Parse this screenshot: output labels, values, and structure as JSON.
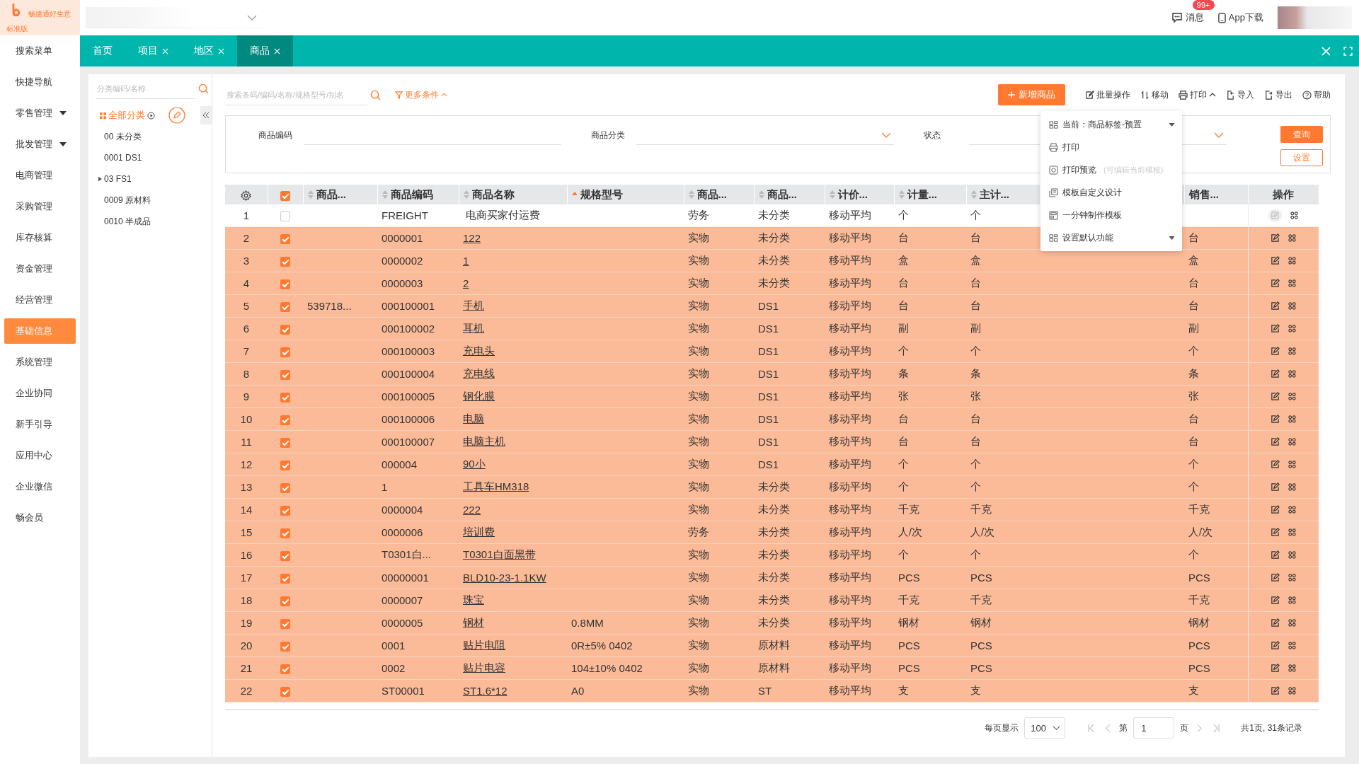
{
  "app": {
    "brand": "畅捷通好生意",
    "edition": "标准版"
  },
  "header": {
    "messages": "消息",
    "badge": "99+",
    "app_download": "App下载"
  },
  "sidebar": {
    "items": [
      {
        "label": "搜索菜单",
        "expandable": false,
        "selected": false
      },
      {
        "label": "快捷导航",
        "expandable": false,
        "selected": false
      },
      {
        "label": "零售管理",
        "expandable": true,
        "selected": false
      },
      {
        "label": "批发管理",
        "expandable": true,
        "selected": false
      },
      {
        "label": "电商管理",
        "expandable": false,
        "selected": false
      },
      {
        "label": "采购管理",
        "expandable": false,
        "selected": false
      },
      {
        "label": "库存核算",
        "expandable": false,
        "selected": false
      },
      {
        "label": "资金管理",
        "expandable": false,
        "selected": false
      },
      {
        "label": "经营管理",
        "expandable": false,
        "selected": false
      },
      {
        "label": "基础信息",
        "expandable": false,
        "selected": true
      },
      {
        "label": "系统管理",
        "expandable": false,
        "selected": false
      },
      {
        "label": "企业协同",
        "expandable": false,
        "selected": false
      },
      {
        "label": "新手引导",
        "expandable": false,
        "selected": false
      },
      {
        "label": "应用中心",
        "expandable": false,
        "selected": false
      },
      {
        "label": "企业微信",
        "expandable": false,
        "selected": false
      },
      {
        "label": "畅会员",
        "expandable": false,
        "selected": false
      }
    ]
  },
  "tabs": [
    {
      "label": "首页",
      "closable": false,
      "selected": false
    },
    {
      "label": "项目",
      "closable": true,
      "selected": false
    },
    {
      "label": "地区",
      "closable": true,
      "selected": false
    },
    {
      "label": "商品",
      "closable": true,
      "selected": true
    }
  ],
  "category_tree": {
    "search_placeholder": "分类编码/名称",
    "root": "全部分类",
    "items": [
      {
        "label": "00 未分类",
        "expandable": false
      },
      {
        "label": "0001 DS1",
        "expandable": false
      },
      {
        "label": "03 FS1",
        "expandable": true
      },
      {
        "label": "0009 原材料",
        "expandable": false
      },
      {
        "label": "0010 半成品",
        "expandable": false
      }
    ]
  },
  "search": {
    "placeholder": "搜索条码/编码/名称/规格型号/别名",
    "more": "更多条件",
    "more_expanded": true
  },
  "toolbar": {
    "add": "新增商品",
    "actions": [
      {
        "kind": "batch",
        "label": "批量操作"
      },
      {
        "kind": "move",
        "label": "移动"
      },
      {
        "kind": "print",
        "label": "打印",
        "expanded": true
      },
      {
        "kind": "import",
        "label": "导入"
      },
      {
        "kind": "export",
        "label": "导出"
      },
      {
        "kind": "help",
        "label": "帮助"
      }
    ]
  },
  "filters": {
    "fields": [
      {
        "label": "商品编码",
        "kind": "text"
      },
      {
        "label": "商品分类",
        "kind": "select"
      },
      {
        "label": "状态",
        "kind": "select"
      }
    ],
    "query": "查询",
    "settings": "设置"
  },
  "print_menu": {
    "items": [
      {
        "kind": "template",
        "label": "当前：商品标签-预置",
        "submenu": true
      },
      {
        "kind": "print",
        "label": "打印",
        "submenu": false
      },
      {
        "kind": "preview",
        "label": "打印预览",
        "hint": "(可编辑当前模板)",
        "submenu": false
      },
      {
        "kind": "design",
        "label": "模板自定义设计",
        "submenu": false
      },
      {
        "kind": "quick",
        "label": "一分钟制作模板",
        "submenu": false
      },
      {
        "kind": "template",
        "label": "设置默认功能",
        "submenu": true
      }
    ]
  },
  "table": {
    "header_checked": true,
    "columns": [
      {
        "kind": "data",
        "label": "商品...",
        "sortable": true,
        "sorted": false
      },
      {
        "kind": "data",
        "label": "商品编码",
        "sortable": true,
        "sorted": false
      },
      {
        "kind": "data",
        "label": "商品名称",
        "sortable": true,
        "sorted": false
      },
      {
        "kind": "data",
        "label": "规格型号",
        "sortable": true,
        "sorted": true
      },
      {
        "kind": "data",
        "label": "商品...",
        "sortable": true,
        "sorted": false
      },
      {
        "kind": "data",
        "label": "商品...",
        "sortable": true,
        "sorted": false
      },
      {
        "kind": "data",
        "label": "计价...",
        "sortable": true,
        "sorted": false
      },
      {
        "kind": "data",
        "label": "计量...",
        "sortable": true,
        "sorted": false
      },
      {
        "kind": "data",
        "label": "主计...",
        "sortable": true,
        "sorted": false
      },
      {
        "kind": "hidden"
      },
      {
        "kind": "hidden"
      },
      {
        "kind": "data",
        "label": "销售...",
        "sortable": false
      },
      {
        "kind": "actions",
        "label": "操作"
      }
    ],
    "rows": [
      {
        "index": "1",
        "selected": false,
        "cells": [
          "",
          "FREIGHT",
          "电商买家付运费",
          "",
          "劳务",
          "未分类",
          "移动平均",
          "个",
          "个",
          "",
          "",
          "",
          ""
        ],
        "link": false,
        "edit_enabled": false
      },
      {
        "index": "2",
        "selected": true,
        "cells": [
          "",
          "0000001",
          "122",
          "",
          "实物",
          "未分类",
          "移动平均",
          "台",
          "台",
          "",
          "",
          "台",
          ""
        ],
        "link": true,
        "edit_enabled": true
      },
      {
        "index": "3",
        "selected": true,
        "cells": [
          "",
          "0000002",
          "1",
          "",
          "实物",
          "未分类",
          "移动平均",
          "盒",
          "盒",
          "",
          "",
          "盒",
          ""
        ],
        "link": true,
        "edit_enabled": true
      },
      {
        "index": "4",
        "selected": true,
        "cells": [
          "",
          "0000003",
          "2",
          "",
          "实物",
          "未分类",
          "移动平均",
          "台",
          "台",
          "",
          "",
          "台",
          ""
        ],
        "link": true,
        "edit_enabled": true
      },
      {
        "index": "5",
        "selected": true,
        "cells": [
          "539718...",
          "000100001",
          "手机",
          "",
          "实物",
          "DS1",
          "移动平均",
          "台",
          "台",
          "",
          "",
          "台",
          ""
        ],
        "link": true,
        "edit_enabled": true
      },
      {
        "index": "6",
        "selected": true,
        "cells": [
          "",
          "000100002",
          "耳机",
          "",
          "实物",
          "DS1",
          "移动平均",
          "副",
          "副",
          "",
          "",
          "副",
          ""
        ],
        "link": true,
        "edit_enabled": true
      },
      {
        "index": "7",
        "selected": true,
        "cells": [
          "",
          "000100003",
          "充电头",
          "",
          "实物",
          "DS1",
          "移动平均",
          "个",
          "个",
          "",
          "",
          "个",
          ""
        ],
        "link": true,
        "edit_enabled": true
      },
      {
        "index": "8",
        "selected": true,
        "cells": [
          "",
          "000100004",
          "充电线",
          "",
          "实物",
          "DS1",
          "移动平均",
          "条",
          "条",
          "",
          "",
          "条",
          ""
        ],
        "link": true,
        "edit_enabled": true
      },
      {
        "index": "9",
        "selected": true,
        "cells": [
          "",
          "000100005",
          "钢化膜",
          "",
          "实物",
          "DS1",
          "移动平均",
          "张",
          "张",
          "",
          "",
          "张",
          ""
        ],
        "link": true,
        "edit_enabled": true
      },
      {
        "index": "10",
        "selected": true,
        "cells": [
          "",
          "000100006",
          "电脑",
          "",
          "实物",
          "DS1",
          "移动平均",
          "台",
          "台",
          "",
          "",
          "台",
          ""
        ],
        "link": true,
        "edit_enabled": true
      },
      {
        "index": "11",
        "selected": true,
        "cells": [
          "",
          "000100007",
          "电脑主机",
          "",
          "实物",
          "DS1",
          "移动平均",
          "台",
          "台",
          "",
          "",
          "台",
          ""
        ],
        "link": true,
        "edit_enabled": true
      },
      {
        "index": "12",
        "selected": true,
        "cells": [
          "",
          "000004",
          "90小",
          "",
          "实物",
          "DS1",
          "移动平均",
          "个",
          "个",
          "",
          "",
          "个",
          ""
        ],
        "link": true,
        "edit_enabled": true
      },
      {
        "index": "13",
        "selected": true,
        "cells": [
          "",
          "1",
          "工具车HM318",
          "",
          "实物",
          "未分类",
          "移动平均",
          "个",
          "个",
          "",
          "",
          "个",
          ""
        ],
        "link": true,
        "edit_enabled": true
      },
      {
        "index": "14",
        "selected": true,
        "cells": [
          "",
          "0000004",
          "222",
          "",
          "实物",
          "未分类",
          "移动平均",
          "千克",
          "千克",
          "",
          "",
          "千克",
          ""
        ],
        "link": true,
        "edit_enabled": true
      },
      {
        "index": "15",
        "selected": true,
        "cells": [
          "",
          "0000006",
          "培训费",
          "",
          "劳务",
          "未分类",
          "移动平均",
          "人/次",
          "人/次",
          "",
          "",
          "人/次",
          ""
        ],
        "link": true,
        "edit_enabled": true
      },
      {
        "index": "16",
        "selected": true,
        "cells": [
          "",
          "T0301白...",
          "T0301白面黑带",
          "",
          "实物",
          "未分类",
          "移动平均",
          "个",
          "个",
          "",
          "",
          "个",
          ""
        ],
        "link": true,
        "edit_enabled": true
      },
      {
        "index": "17",
        "selected": true,
        "cells": [
          "",
          "00000001",
          "BLD10-23-1.1KW",
          "",
          "实物",
          "未分类",
          "移动平均",
          "PCS",
          "PCS",
          "",
          "",
          "PCS",
          ""
        ],
        "link": true,
        "edit_enabled": true
      },
      {
        "index": "18",
        "selected": true,
        "cells": [
          "",
          "0000007",
          "珠宝",
          "",
          "实物",
          "未分类",
          "移动平均",
          "千克",
          "千克",
          "",
          "",
          "千克",
          ""
        ],
        "link": true,
        "edit_enabled": true
      },
      {
        "index": "19",
        "selected": true,
        "cells": [
          "",
          "0000005",
          "钢材",
          "0.8MM",
          "实物",
          "未分类",
          "移动平均",
          "钢材",
          "钢材",
          "",
          "",
          "钢材",
          ""
        ],
        "link": true,
        "edit_enabled": true
      },
      {
        "index": "20",
        "selected": true,
        "cells": [
          "",
          "0001",
          "贴片电阻",
          "0R±5% 0402",
          "实物",
          "原材料",
          "移动平均",
          "PCS",
          "PCS",
          "",
          "",
          "PCS",
          ""
        ],
        "link": true,
        "edit_enabled": true
      },
      {
        "index": "21",
        "selected": true,
        "cells": [
          "",
          "0002",
          "贴片电容",
          "104±10% 0402",
          "实物",
          "原材料",
          "移动平均",
          "PCS",
          "PCS",
          "",
          "",
          "PCS",
          ""
        ],
        "link": true,
        "edit_enabled": true
      },
      {
        "index": "22",
        "selected": true,
        "cells": [
          "",
          "ST00001",
          "ST1.6*12",
          "A0",
          "实物",
          "ST",
          "移动平均",
          "支",
          "支",
          "",
          "",
          "支",
          ""
        ],
        "link": true,
        "edit_enabled": true
      }
    ]
  },
  "pagination": {
    "page_size_label": "每页显示",
    "page_size": "100",
    "page_prefix": "第",
    "page": "1",
    "page_suffix": "页",
    "summary": "共1页, 31条记录"
  }
}
